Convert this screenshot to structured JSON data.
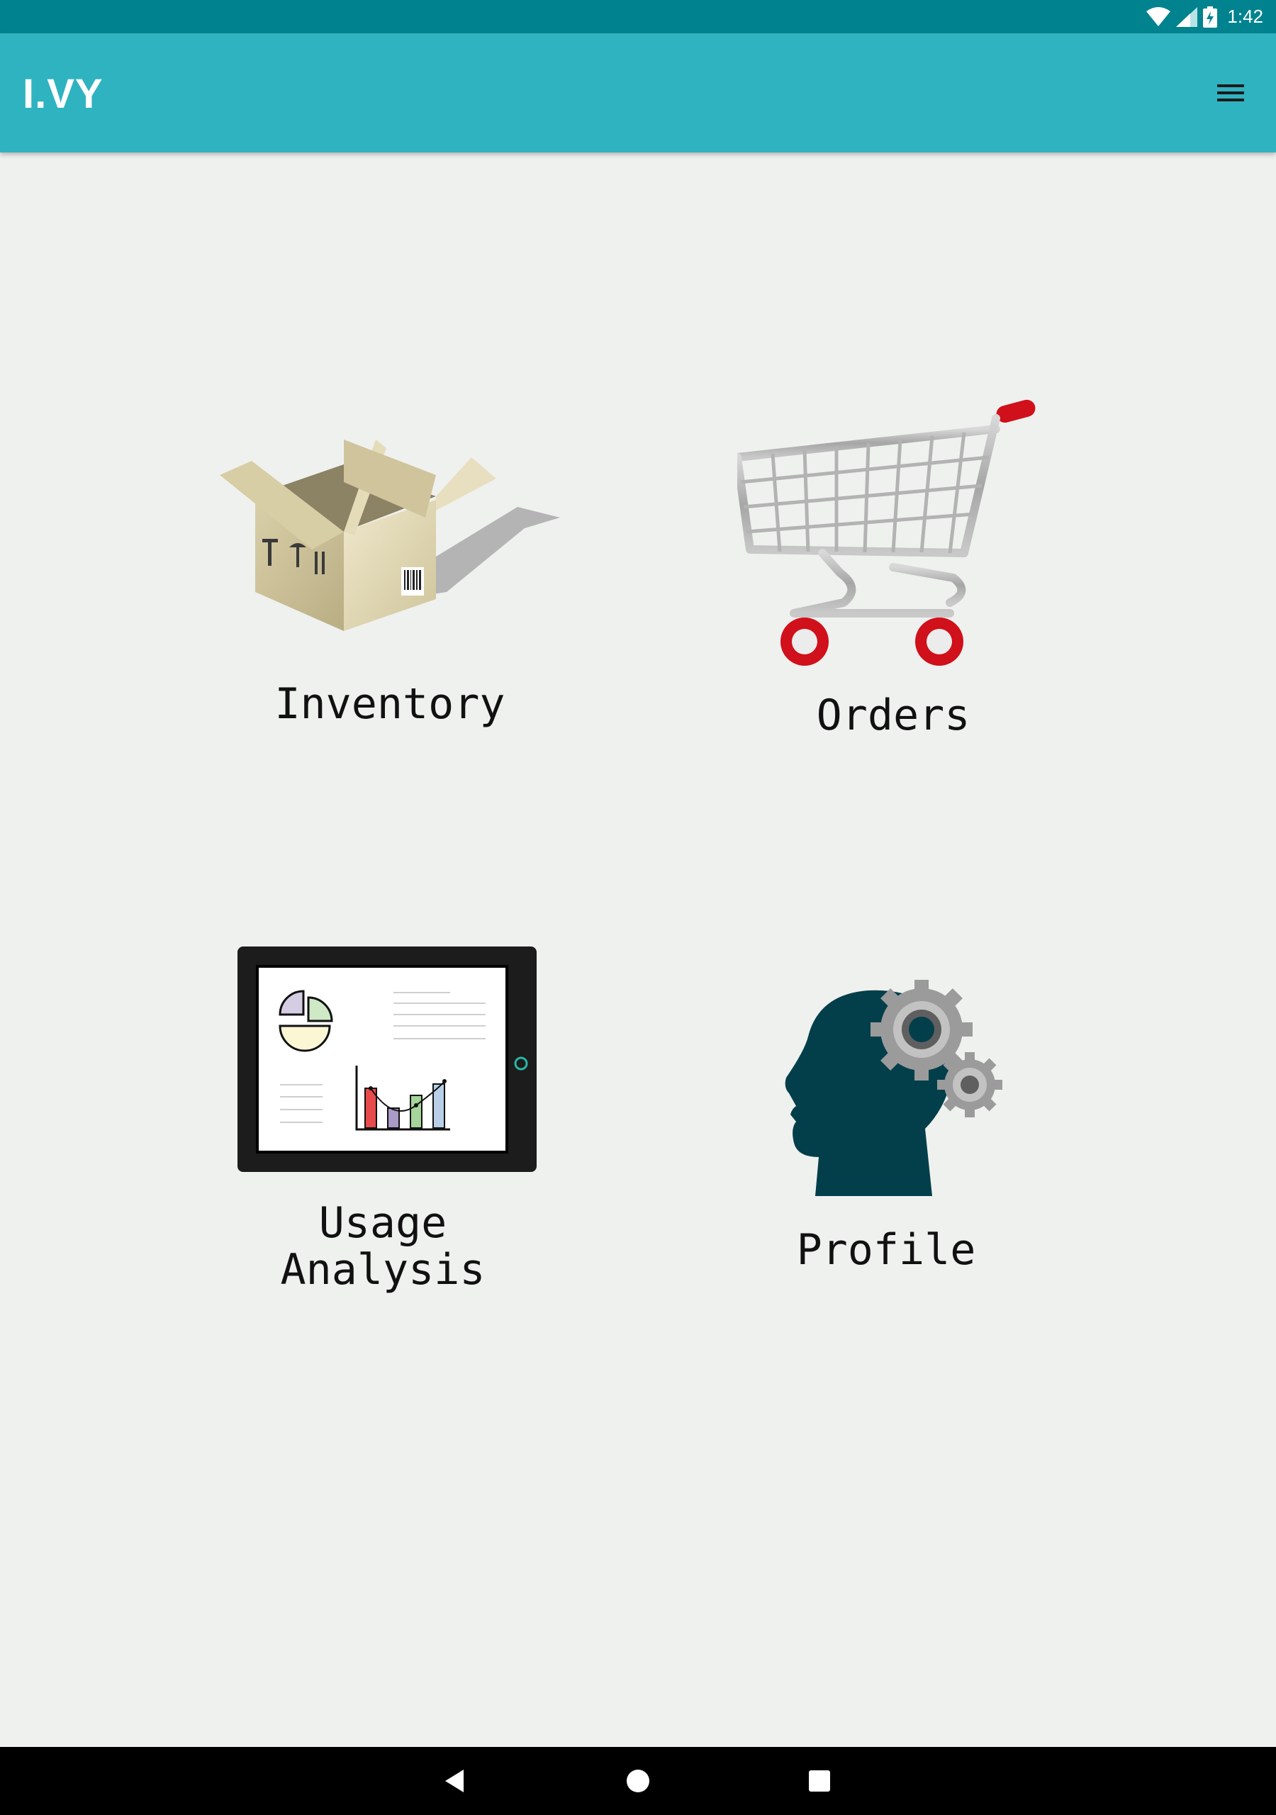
{
  "status_bar": {
    "time": "1:42",
    "icons": [
      "wifi-icon",
      "signal-icon",
      "battery-charging-icon"
    ]
  },
  "app_bar": {
    "title": "I.VY",
    "menu_icon": "menu-icon"
  },
  "tiles": [
    {
      "label": "Inventory",
      "icon": "box-icon"
    },
    {
      "label": "Orders",
      "icon": "shopping-cart-icon"
    },
    {
      "label_line1": "Usage",
      "label_line2": "Analysis",
      "icon": "tablet-chart-icon"
    },
    {
      "label": "Profile",
      "icon": "head-gears-icon"
    }
  ],
  "nav_bar": {
    "buttons": [
      "back-icon",
      "home-icon",
      "recents-icon"
    ]
  },
  "colors": {
    "status_bar": "#00838f",
    "app_bar": "#30b3c0",
    "background": "#eff1ef",
    "cart_accent": "#d0101a",
    "profile_head": "#033f4a"
  }
}
